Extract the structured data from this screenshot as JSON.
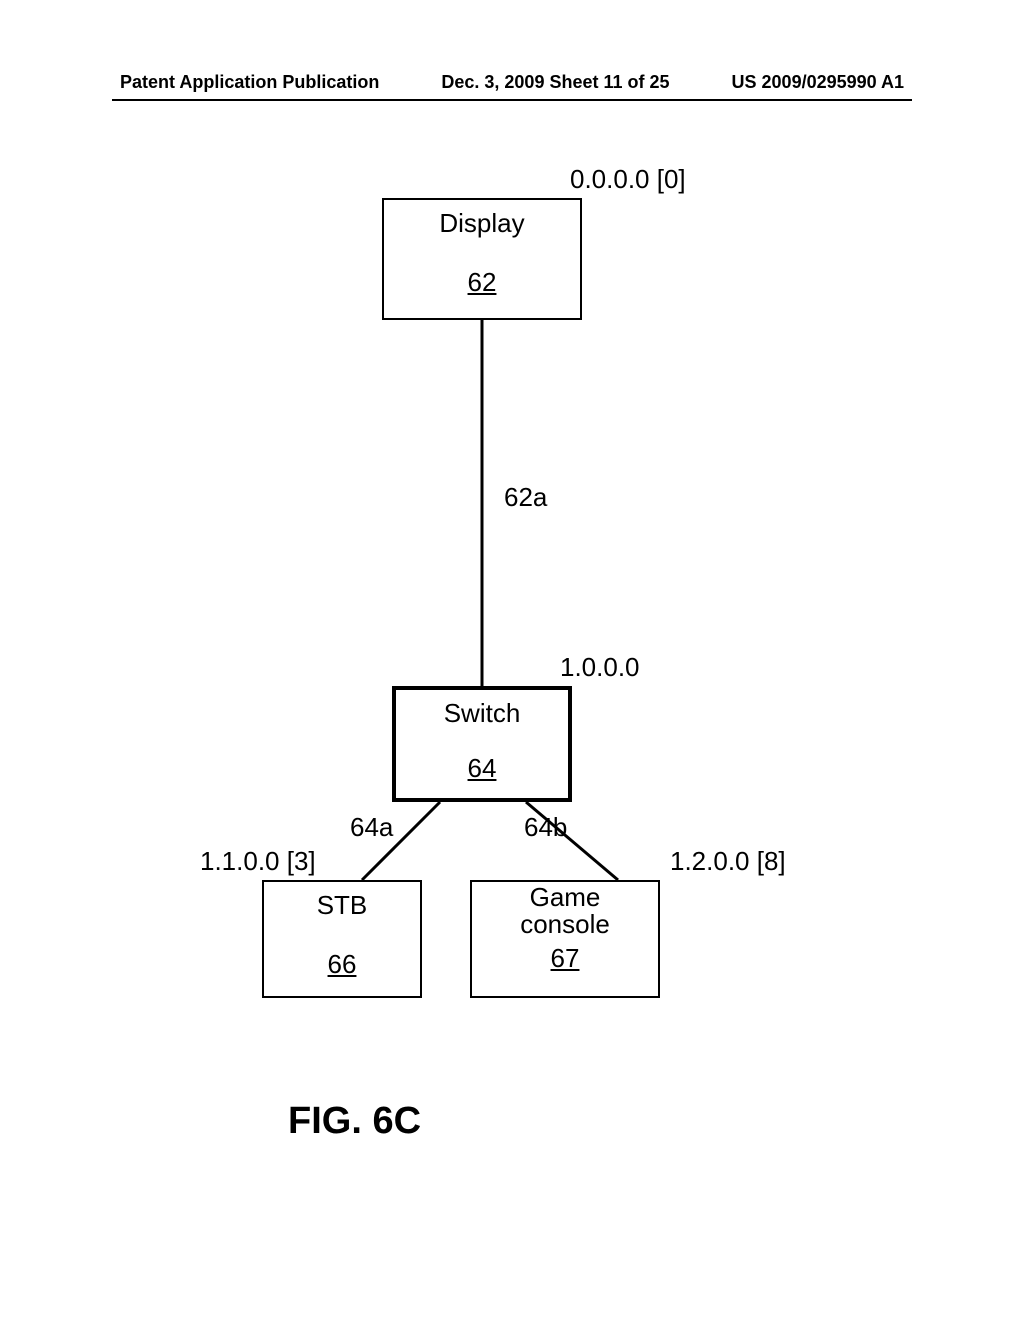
{
  "header": {
    "left": "Patent Application Publication",
    "center": "Dec. 3, 2009   Sheet 11 of 25",
    "right": "US 2009/0295990 A1"
  },
  "nodes": {
    "display": {
      "label": "Display",
      "ref": "62",
      "addr": "0.0.0.0 [0]"
    },
    "switch": {
      "label": "Switch",
      "ref": "64",
      "addr": "1.0.0.0"
    },
    "stb": {
      "label": "STB",
      "ref": "66",
      "addr": "1.1.0.0 [3]"
    },
    "game": {
      "label1": "Game",
      "label2": "console",
      "ref": "67",
      "addr": "1.2.0.0 [8]"
    }
  },
  "edges": {
    "display_switch": "62a",
    "switch_stb": "64a",
    "switch_game": "64b"
  },
  "figure": {
    "caption": "FIG. 6C"
  }
}
